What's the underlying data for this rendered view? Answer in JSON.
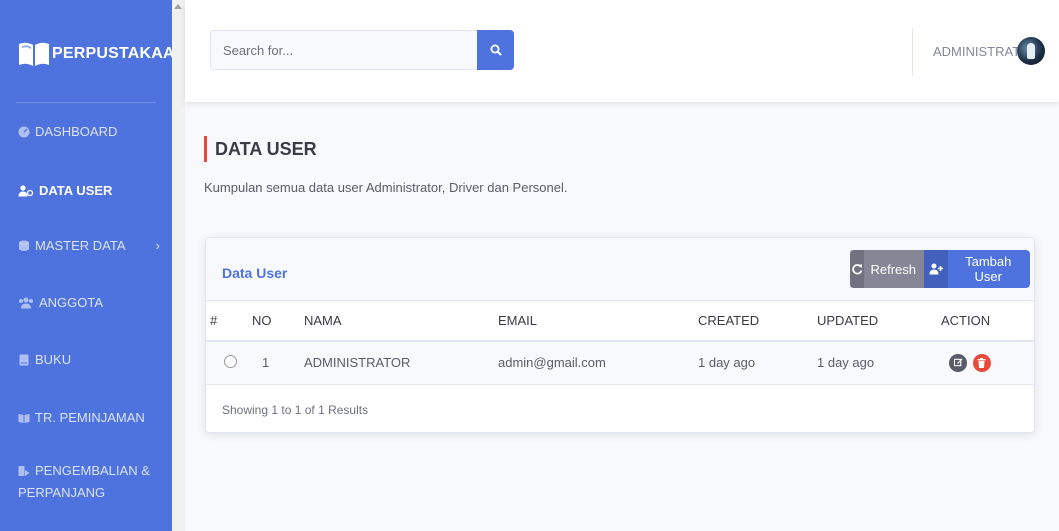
{
  "sidebar": {
    "brand": "PERPUSTAKAAN",
    "items": [
      {
        "label": "DASHBOARD",
        "icon": "dashboard-icon"
      },
      {
        "label": "DATA USER",
        "icon": "users-icon",
        "active": true
      },
      {
        "label": "MASTER DATA",
        "icon": "database-icon"
      },
      {
        "label": "ANGGOTA",
        "icon": "members-icon"
      },
      {
        "label": "BUKU",
        "icon": "book-icon"
      },
      {
        "label": "TR. PEMINJAMAN",
        "icon": "book-open-icon"
      },
      {
        "label_line1": "PENGEMBALIAN &",
        "label_line2": "PERPANJANG",
        "icon": "return-icon"
      }
    ]
  },
  "topbar": {
    "search_placeholder": "Search for...",
    "user_name": "ADMINISTRATOR"
  },
  "page": {
    "title": "DATA USER",
    "description": "Kumpulan semua data user Administrator, Driver dan Personel."
  },
  "card": {
    "title": "Data User",
    "refresh_label": "Refresh",
    "add_label": "Tambah User",
    "columns": [
      "#",
      "NO",
      "NAMA",
      "EMAIL",
      "CREATED",
      "UPDATED",
      "ACTION"
    ],
    "rows": [
      {
        "no": "1",
        "nama": "ADMINISTRATOR",
        "email": "admin@gmail.com",
        "created": "1 day ago",
        "updated": "1 day ago"
      }
    ],
    "footer": "Showing 1 to 1 of 1 Results"
  },
  "colors": {
    "primary": "#4e73df",
    "danger": "#e74a3b",
    "secondary": "#858796"
  }
}
